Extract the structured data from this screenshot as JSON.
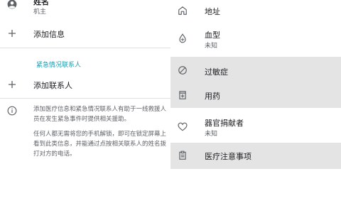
{
  "owner": {
    "name": "姓名",
    "subtitle": "机主"
  },
  "left": {
    "add_info": "添加信息",
    "section_title": "紧急情况联系人",
    "add_contact": "添加联系人",
    "info_paragraph_1": "添加医疗信息和紧急情况联系人有助于一线救援人员在发生紧急事件时提供相关援助。",
    "info_paragraph_2": "任何人都无需将您的手机解锁，即可在锁定屏幕上看到此类信息，并能通过点按相关联系人的姓名拨打对方的电话。"
  },
  "right": {
    "items": [
      {
        "label": "地址",
        "sub": ""
      },
      {
        "label": "血型",
        "sub": "未知"
      },
      {
        "label": "过敏症",
        "sub": ""
      },
      {
        "label": "用药",
        "sub": ""
      },
      {
        "label": "器官捐献者",
        "sub": "未知"
      },
      {
        "label": "医疗注意事项",
        "sub": ""
      }
    ]
  },
  "colors": {
    "accent": "#1a9bb0",
    "highlight": "#e4e4e4"
  }
}
